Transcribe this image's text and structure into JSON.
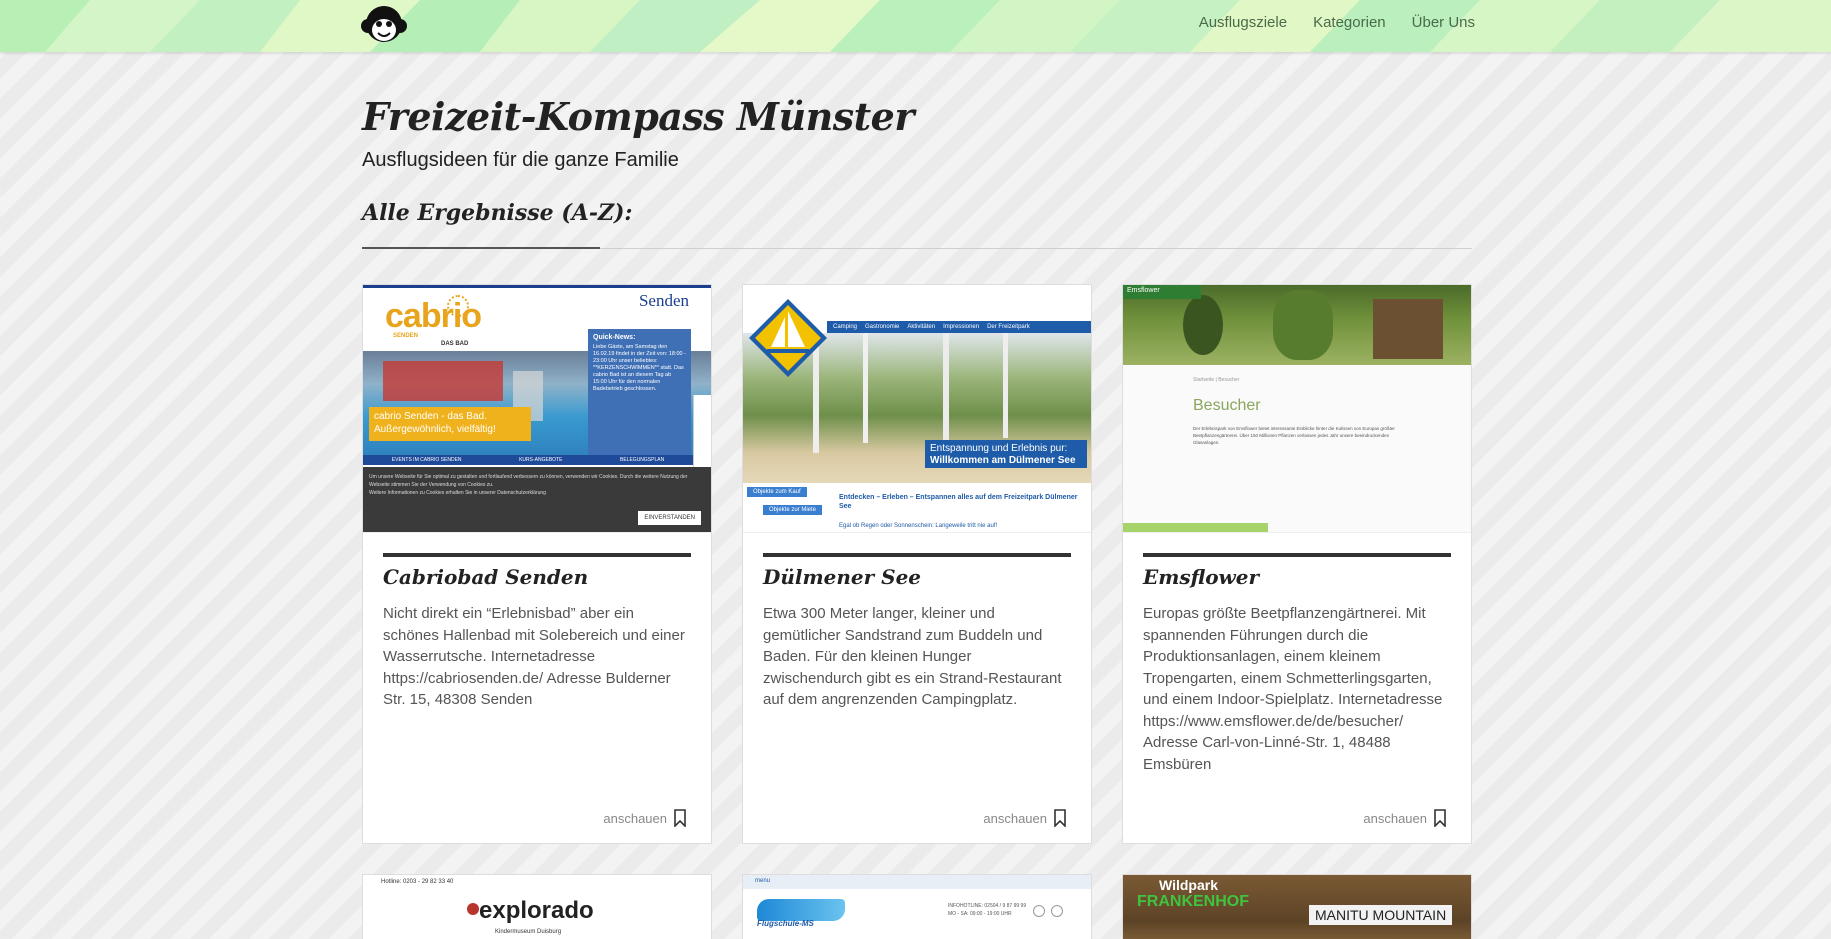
{
  "nav": {
    "items": [
      "Ausflugsziele",
      "Kategorien",
      "Über Uns"
    ]
  },
  "logo_icon": "monkey-head-icon",
  "header": {
    "title": "Freizeit-Kompass Münster",
    "subtitle": "Ausflugsideen für die ganze Familie"
  },
  "section": {
    "title": "Alle Ergebnisse (A-Z):"
  },
  "colors": {
    "header_bg": "#c8f2c6",
    "accent_bar": "#333333"
  },
  "cards": [
    {
      "title": "Cabriobad Senden",
      "text": "Nicht direkt ein “Erlebnisbad” aber ein schönes Hallenbad mit Solebereich und einer Wasserrutsche. Internetadresse https://cabriosenden.de/ Adresse Bulderner Str. 15, 48308 Senden",
      "link": "anschauen",
      "thumb": {
        "brand": "cabrio",
        "brand_sub": "SENDEN",
        "brand_tag": "DAS BAD",
        "town": "Senden",
        "news_title": "Quick-News:",
        "news_text": "Liebe Gäste, am Samstag den 16.02.19 findet in der Zeit von: 18:00 - 23:00 Uhr unser beliebtes: **KERZENSCHWIMMEN** statt. Das cabrio Bad ist an diesem Tag ab 15:00 Uhr für den normalen Badebetrieb geschlossen.",
        "hero_line1": "cabrio Senden - das Bad.",
        "hero_line2": "Außergewöhnlich, vielfältig!",
        "tabs": [
          "EVENTS IM CABRIO SENDEN",
          "KURS-ANGEBOTE",
          "BELEGUNGSPLAN"
        ],
        "cookie_text": "Um unsere Webseite für Sie optimal zu gestalten und fortlaufend verbessern zu können, verwenden wir Cookies. Durch die weitere Nutzung der Webseite stimmen Sie der Verwendung von Cookies zu.",
        "cookie_more": "Weitere Informationen zu Cookies erhalten Sie in unserer Datenschutzerklärung",
        "cookie_button": "EINVERSTANDEN"
      }
    },
    {
      "title": "Dülmener See",
      "text": "Etwa 300 Meter langer, kleiner und gemütlicher Sandstrand zum Buddeln und Baden. Für den kleinen Hunger zwischendurch gibt es ein Strand-Restaurant auf dem angrenzenden Campingplatz.",
      "link": "anschauen",
      "thumb": {
        "menu": [
          "Camping",
          "Gastronomie",
          "Aktivitäten",
          "Impressionen",
          "Der Freizeitpark"
        ],
        "banner_line1": "Entspannung und Erlebnis pur:",
        "banner_line2": "Willkommen am Dülmener See",
        "btn1": "Objekte zum Kauf",
        "btn2": "Objekte zur Miete",
        "headline": "Entdecken – Erleben – Entspannen alles auf dem Freizeitpark Dülmener See",
        "subline": "Egal ob Regen oder Sonnenschein: Langeweile tritt nie auf!"
      }
    },
    {
      "title": "Emsflower",
      "text": "Europas größte Beetpflanzengärtnerei. Mit spannenden Führungen durch die Produktionsanlagen, einem kleinem Tropengarten, einem Schmetterlingsgarten, und einem Indoor-Spielplatz. Internetadresse https://www.emsflower.de/de/besucher/ Adresse Carl-von-Linné-Str. 1, 48488 Emsbüren",
      "link": "anschauen",
      "thumb": {
        "brand": "Emsflower",
        "heading": "Besucher",
        "crumb": "Startseite | Besucher",
        "body": "Der Erlebnispark von Emsflower bietet interessante Einblicke hinter die Kulissen von Europas größter Beetpflanzengärtnerei. Über 150 Millionen Pflanzen verlassen jedes Jahr unsere beeindruckenden Glasanlagen."
      }
    },
    {
      "thumb": {
        "hotline": "Hotline: 0203 - 29 82 33 40",
        "brand": "explorado",
        "sub": "Kindermuseum Duisburg"
      }
    },
    {
      "thumb": {
        "menu": "menu",
        "brand": "Flugschule-MS",
        "info": "INFOHOTLINE: 02504 / 9 87 99 99",
        "hours": "MO - SA: 09:00 - 19:00 UHR"
      }
    },
    {
      "thumb": {
        "brand_line1": "Wildpark",
        "brand_line2": "FRANKENHOF",
        "label": "MANITU MOUNTAIN"
      }
    }
  ]
}
